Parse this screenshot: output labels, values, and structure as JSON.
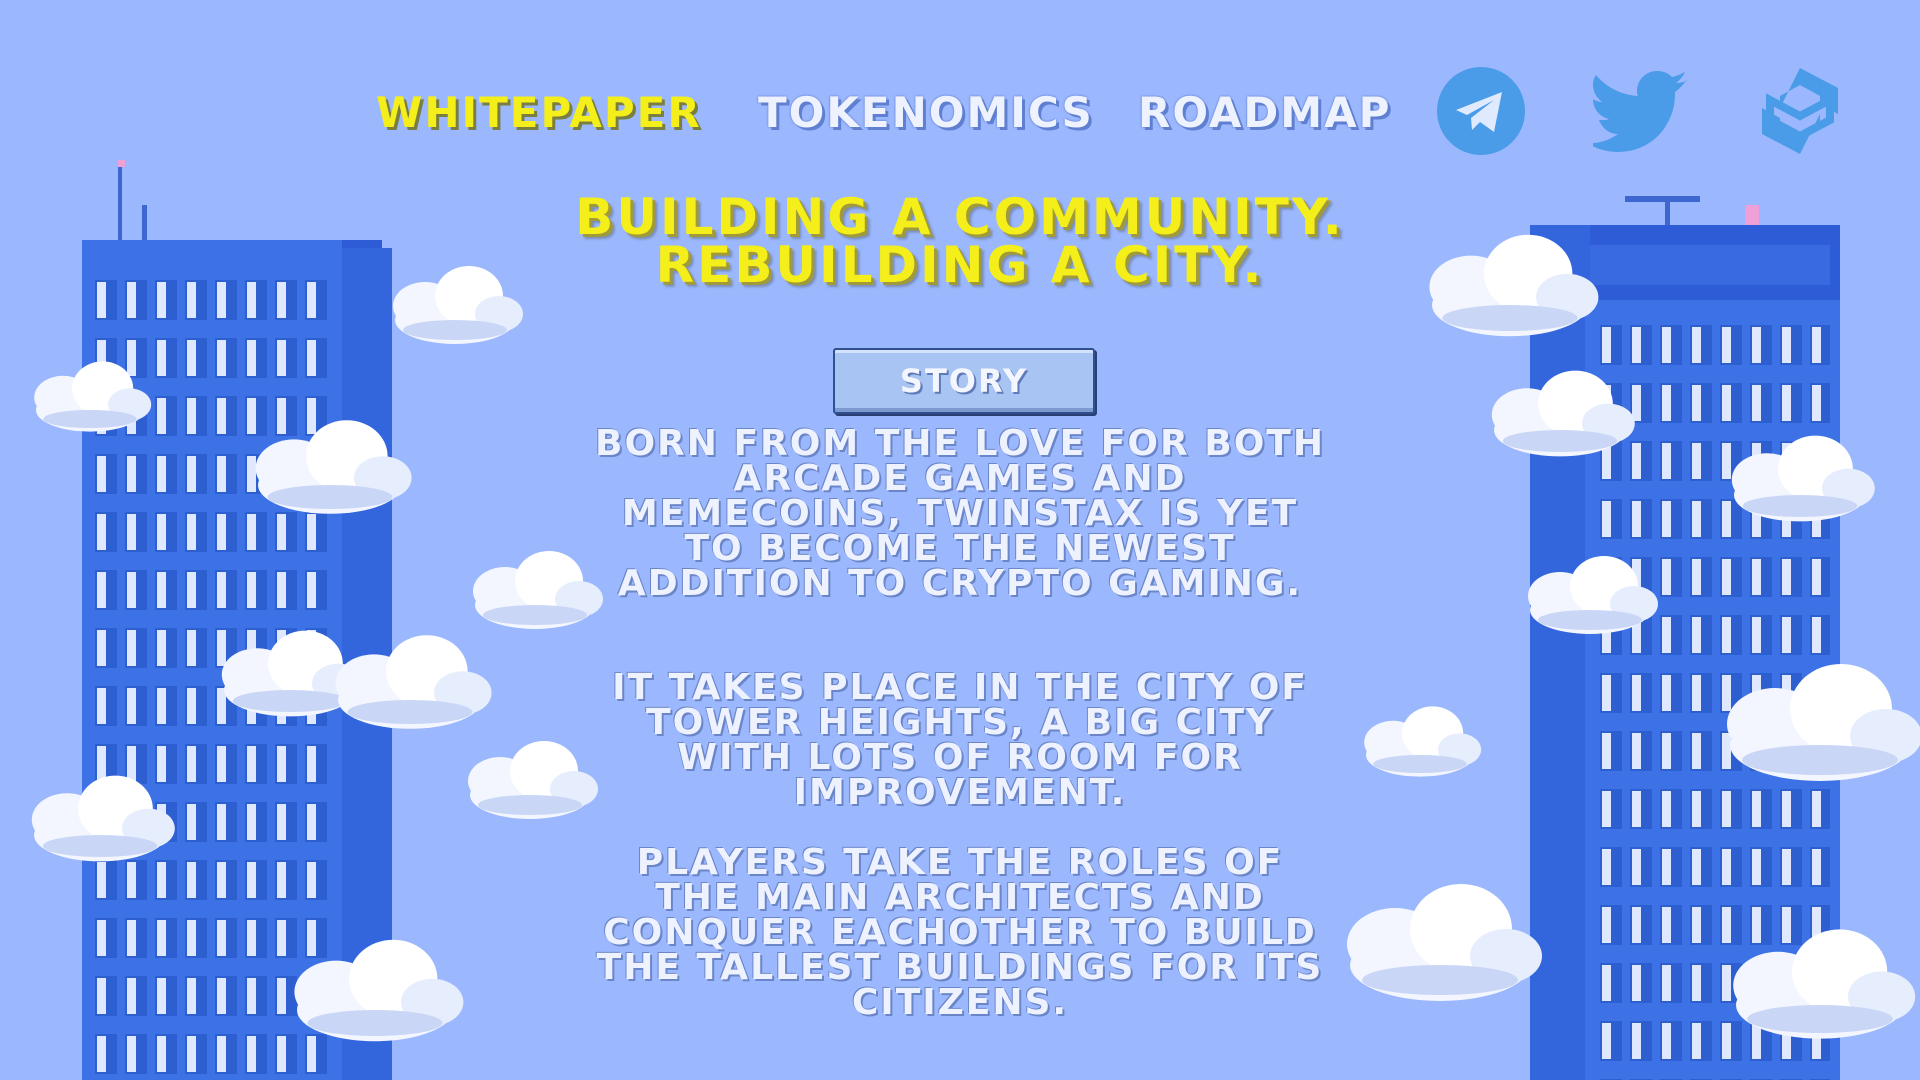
{
  "nav": {
    "links": [
      {
        "label": "WHITEPAPER"
      },
      {
        "label": "TOKENOMICS"
      },
      {
        "label": "ROADMAP"
      }
    ],
    "social": [
      "telegram-icon",
      "twitter-icon",
      "dextools-icon"
    ]
  },
  "hero": {
    "title_line1": "BUILDING A COMMUNITY.",
    "title_line2": "REBUILDING A CITY."
  },
  "story": {
    "button_label": "STORY",
    "paragraphs": [
      "BORN FROM THE LOVE FOR BOTH ARCADE GAMES AND MEMECOINS, TWINSTAX IS YET TO BECOME THE NEWEST ADDITION TO CRYPTO GAMING.",
      "IT TAKES PLACE IN THE CITY OF TOWER HEIGHTS, A BIG CITY WITH LOTS OF ROOM FOR IMPROVEMENT.",
      "PLAYERS TAKE THE ROLES OF THE MAIN ARCHITECTS AND CONQUER EACHOTHER TO BUILD THE TALLEST BUILDINGS FOR ITS CITIZENS."
    ]
  },
  "colors": {
    "background": "#9bb7fd",
    "accent_yellow": "#f4ee1a",
    "building_blue": "#3d72e6",
    "social_blue": "#4a9be8"
  }
}
